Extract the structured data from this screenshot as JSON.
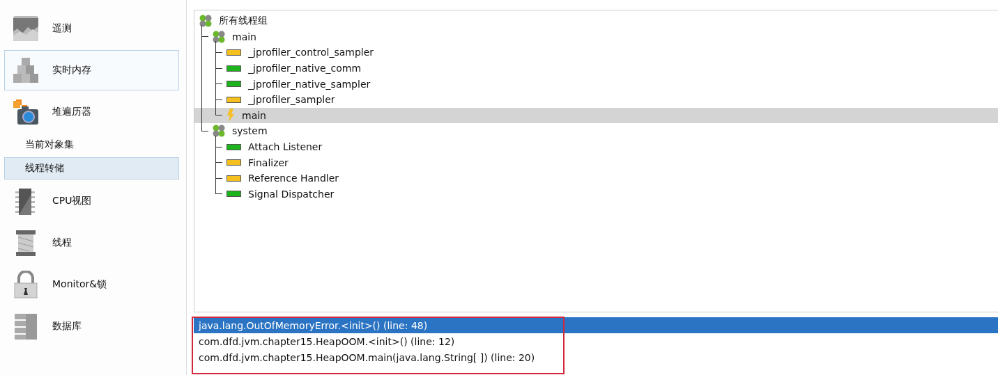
{
  "sidebar": {
    "items": [
      {
        "kind": "view",
        "label": "遥测",
        "selected": false
      },
      {
        "kind": "view",
        "label": "实时内存",
        "selected": true
      },
      {
        "kind": "view",
        "label": "堆遍历器",
        "selected": false
      },
      {
        "kind": "sub",
        "label": "当前对象集",
        "selected": false
      },
      {
        "kind": "sub",
        "label": "线程转储",
        "selected": true
      },
      {
        "kind": "view",
        "label": "CPU视图",
        "selected": false
      },
      {
        "kind": "view",
        "label": "线程",
        "selected": false
      },
      {
        "kind": "view",
        "label": "Monitor&锁",
        "selected": false
      },
      {
        "kind": "view",
        "label": "数据库",
        "selected": false
      }
    ]
  },
  "thread_tree": {
    "root": {
      "kind": "group",
      "label": "所有线程组",
      "selected": false,
      "children": [
        {
          "kind": "group",
          "label": "main",
          "selected": false,
          "children": [
            {
              "kind": "thread",
              "label": "_jprofiler_control_sampler",
              "color": "#f5bf1d",
              "selected": false
            },
            {
              "kind": "thread",
              "label": "_jprofiler_native_comm",
              "color": "#1db31d",
              "selected": false
            },
            {
              "kind": "thread",
              "label": "_jprofiler_native_sampler",
              "color": "#1db31d",
              "selected": false
            },
            {
              "kind": "thread",
              "label": "_jprofiler_sampler",
              "color": "#f5bf1d",
              "selected": false
            },
            {
              "kind": "current",
              "label": "main",
              "selected": true
            }
          ]
        },
        {
          "kind": "group",
          "label": "system",
          "selected": false,
          "children": [
            {
              "kind": "thread",
              "label": "Attach Listener",
              "color": "#1db31d",
              "selected": false
            },
            {
              "kind": "thread",
              "label": "Finalizer",
              "color": "#f5bf1d",
              "selected": false
            },
            {
              "kind": "thread",
              "label": "Reference Handler",
              "color": "#f5bf1d",
              "selected": false
            },
            {
              "kind": "thread",
              "label": "Signal Dispatcher",
              "color": "#1db31d",
              "selected": false
            }
          ]
        }
      ]
    }
  },
  "stack_trace": {
    "frames": [
      {
        "text": "java.lang.OutOfMemoryError.<init>() (line: 48)",
        "selected": true
      },
      {
        "text": "com.dfd.jvm.chapter15.HeapOOM.<init>() (line: 12)",
        "selected": false
      },
      {
        "text": "com.dfd.jvm.chapter15.HeapOOM.main(java.lang.String[ ]) (line: 20)",
        "selected": false
      }
    ]
  }
}
